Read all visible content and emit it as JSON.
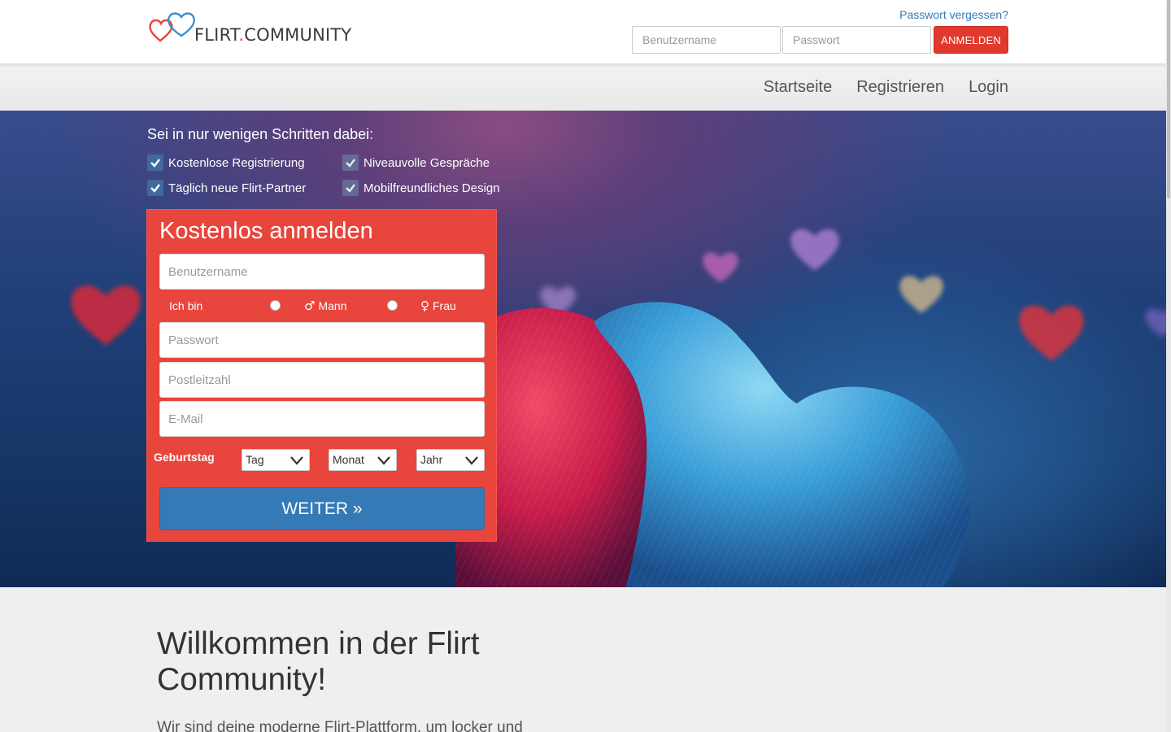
{
  "header": {
    "logo_text_1": "FLIRT",
    "logo_dot": ".",
    "logo_text_2": "COMMUNITY",
    "forgot_password": "Passwort vergessen?",
    "username_placeholder": "Benutzername",
    "password_placeholder": "Passwort",
    "login_button": "ANMELDEN"
  },
  "nav": {
    "items": [
      {
        "label": "Startseite"
      },
      {
        "label": "Registrieren"
      },
      {
        "label": "Login"
      }
    ]
  },
  "hero": {
    "steps_title": "Sei in nur wenigen Schritten dabei:",
    "features": [
      {
        "label": "Kostenlose Registrierung"
      },
      {
        "label": "Niveauvolle Gespräche"
      },
      {
        "label": "Täglich neue Flirt-Partner"
      },
      {
        "label": "Mobilfreundliches Design"
      }
    ]
  },
  "register": {
    "title": "Kostenlos anmelden",
    "username_placeholder": "Benutzername",
    "gender_label": "Ich bin",
    "gender_male": "Mann",
    "gender_female": "Frau",
    "password_placeholder": "Passwort",
    "zip_placeholder": "Postleitzahl",
    "email_placeholder": "E-Mail",
    "birthday_label": "Geburtstag",
    "day_select": "Tag",
    "month_select": "Monat",
    "year_select": "Jahr",
    "submit_button": "WEITER »"
  },
  "welcome": {
    "title": "Willkommen in der Flirt Community!",
    "intro": "Wir sind deine moderne Flirt-Plattform, um locker und"
  },
  "colors": {
    "accent_red": "#e8453c",
    "primary_blue": "#337ab7",
    "link_blue": "#337ab7"
  }
}
